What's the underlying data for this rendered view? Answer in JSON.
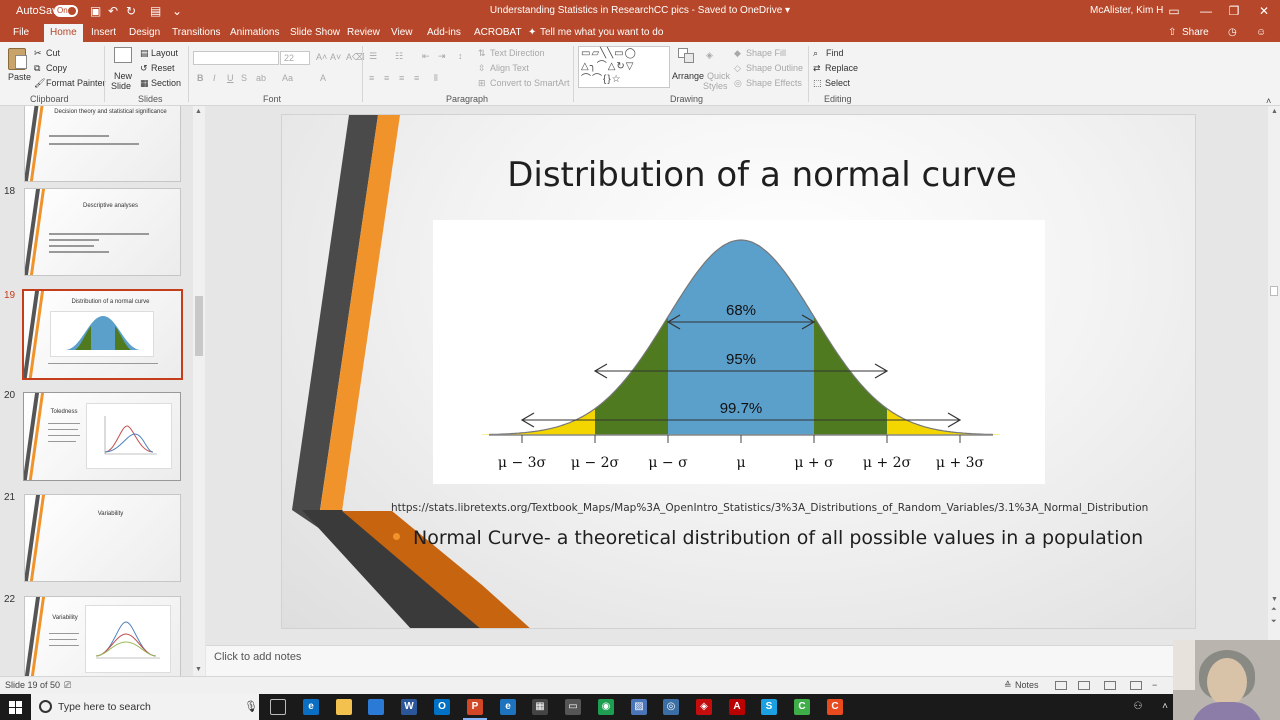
{
  "titlebar": {
    "autosave_label": "AutoSave",
    "autosave_state": "On",
    "doc_title": "Understanding Statistics in ResearchCC pics  -  Saved to OneDrive  ▾",
    "user": "McAlister, Kim H"
  },
  "tabs": [
    "File",
    "Home",
    "Insert",
    "Design",
    "Transitions",
    "Animations",
    "Slide Show",
    "Review",
    "View",
    "Add-ins",
    "ACROBAT"
  ],
  "active_tab": "Home",
  "tell_me": "Tell me what you want to do",
  "share": "Share",
  "ribbon": {
    "clipboard": {
      "label": "Clipboard",
      "paste": "Paste",
      "cut": "Cut",
      "copy": "Copy",
      "format_painter": "Format Painter"
    },
    "slides": {
      "label": "Slides",
      "new_slide": "New",
      "new_slide2": "Slide",
      "layout": "Layout",
      "reset": "Reset",
      "section": "Section"
    },
    "font": {
      "label": "Font",
      "size": "22"
    },
    "paragraph": {
      "label": "Paragraph",
      "text_direction": "Text Direction",
      "align_text": "Align Text",
      "smartart": "Convert to SmartArt"
    },
    "drawing": {
      "label": "Drawing",
      "arrange": "Arrange",
      "quick_styles": "Quick",
      "quick_styles2": "Styles",
      "shape_fill": "Shape Fill",
      "shape_outline": "Shape Outline",
      "shape_effects": "Shape Effects"
    },
    "editing": {
      "label": "Editing",
      "find": "Find",
      "replace": "Replace",
      "select": "Select"
    }
  },
  "thumbnails": [
    {
      "num": "",
      "title": "Decision theory and statistical significance",
      "lines": [
        "Alpha value is selected",
        "If value is p≤α, there is no meaning to the difference"
      ]
    },
    {
      "num": "18",
      "title": "Descriptive analyses",
      "lines": [
        "Helps to describe, display, or summarize data in a meaningful way",
        "Measures of central tendency",
        "Measures of spread",
        "No conclusions about the values"
      ]
    },
    {
      "num": "19",
      "title": "Distribution of a normal curve",
      "lines": [
        "Normal curve- a theoretical distribution of all possible values in a population"
      ]
    },
    {
      "num": "20",
      "title": "Toledness",
      "lines": []
    },
    {
      "num": "21",
      "title": "Variability",
      "lines": []
    },
    {
      "num": "22",
      "title": "Variability",
      "lines": []
    }
  ],
  "slide": {
    "title": "Distribution of a normal curve",
    "url": "https://stats.libretexts.org/Textbook_Maps/Map%3A_OpenIntro_Statistics/3%3A_Distributions_of_Random_Variables/3.1%3A_Normal_Distribution",
    "bullet": "Normal Curve- a theoretical distribution of all possible values in a population",
    "figure": {
      "labels": [
        "68%",
        "95%",
        "99.7%"
      ],
      "axis_ticks": [
        "μ − 3σ",
        "μ − 2σ",
        "μ − σ",
        "μ",
        "μ + σ",
        "μ + 2σ",
        "μ + 3σ"
      ],
      "colors": {
        "center": "#5b9fcb",
        "mid": "#4f7a1f",
        "outer": "#f3d600"
      }
    }
  },
  "notes_placeholder": "Click to add notes",
  "status": {
    "slide_info": "Slide 19 of 50",
    "notes_btn": "Notes"
  },
  "taskbar": {
    "search_placeholder": "Type here to search"
  }
}
